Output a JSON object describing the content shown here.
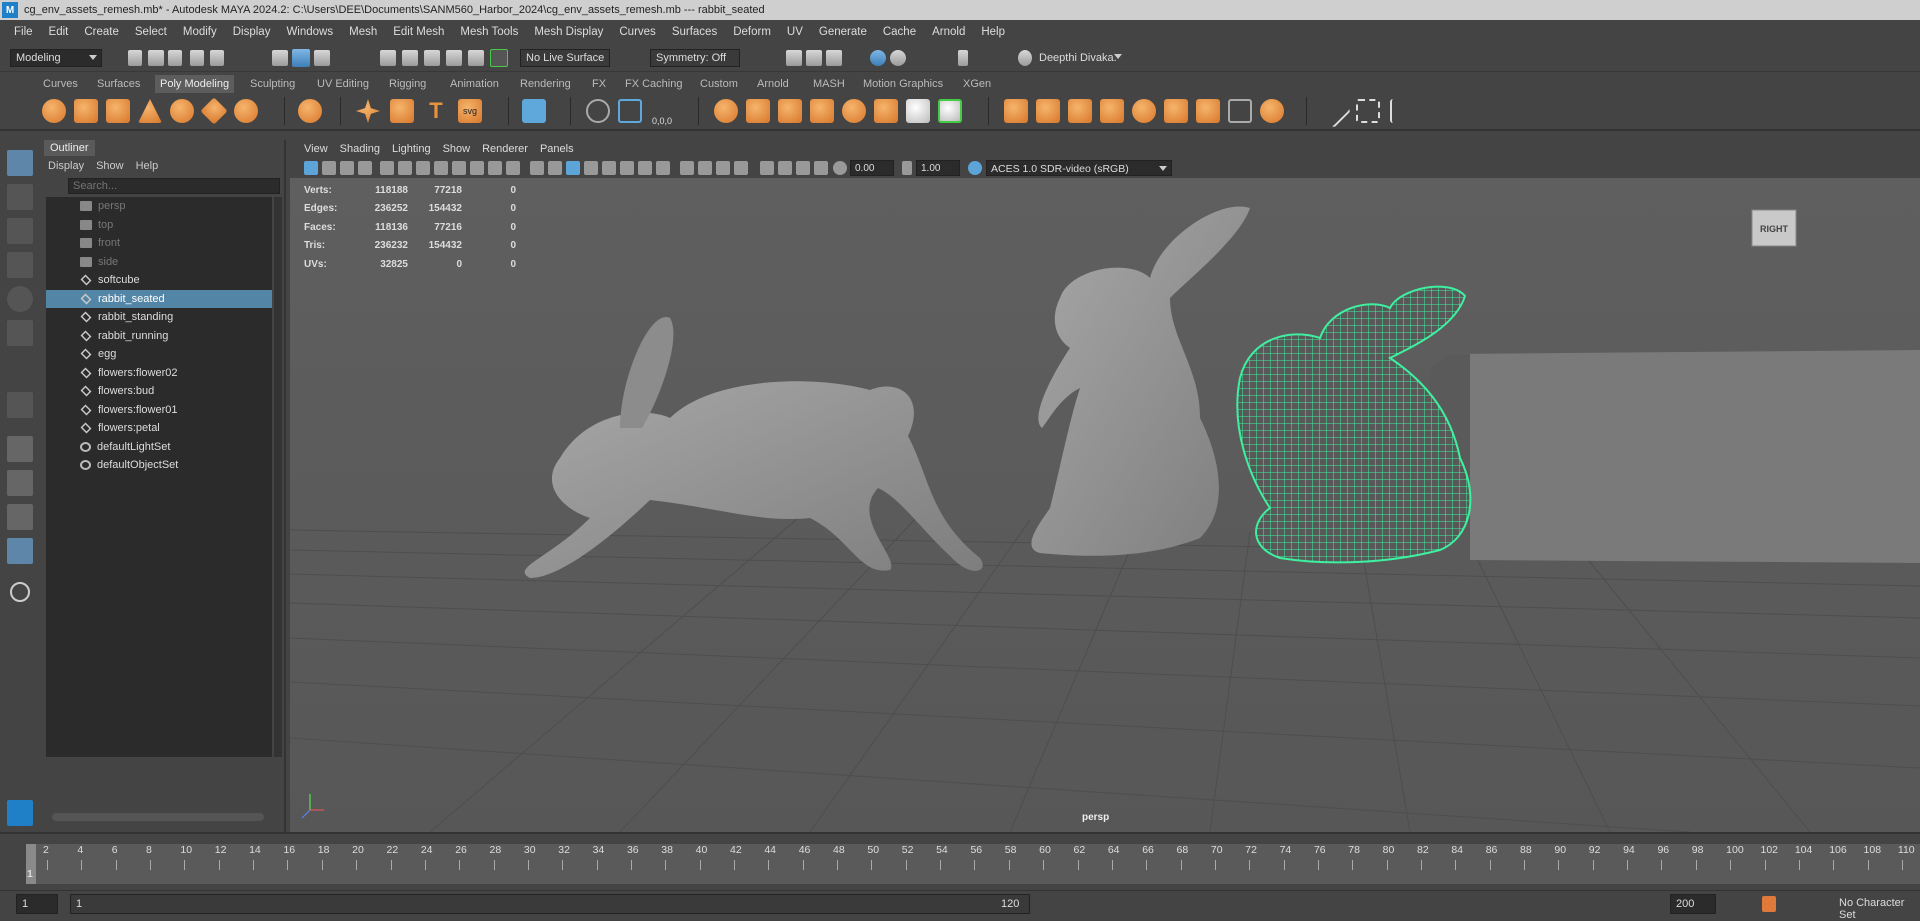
{
  "window": {
    "title": "cg_env_assets_remesh.mb* - Autodesk MAYA 2024.2: C:\\Users\\DEE\\Documents\\SANM560_Harbor_2024\\cg_env_assets_remesh.mb  ---  rabbit_seated",
    "app_badge": "M"
  },
  "menubar": [
    "File",
    "Edit",
    "Create",
    "Select",
    "Modify",
    "Display",
    "Windows",
    "Mesh",
    "Edit Mesh",
    "Mesh Tools",
    "Mesh Display",
    "Curves",
    "Surfaces",
    "Deform",
    "UV",
    "Generate",
    "Cache",
    "Arnold",
    "Help"
  ],
  "statusline": {
    "menuset": "Modeling",
    "live_surface": "No Live Surface",
    "symmetry": "Symmetry: Off",
    "user": "Deepthi Divaka."
  },
  "shelf_tabs": [
    "Curves",
    "Surfaces",
    "Poly Modeling",
    "Sculpting",
    "UV Editing",
    "Rigging",
    "Animation",
    "Rendering",
    "FX",
    "FX Caching",
    "Custom",
    "Arnold",
    "MASH",
    "Motion Graphics",
    "XGen"
  ],
  "shelf_active_tab": "Poly Modeling",
  "shelf_text_icons": {
    "svg": "svg",
    "coord": "0,0,0"
  },
  "outliner": {
    "title": "Outliner",
    "menu": [
      "Display",
      "Show",
      "Help"
    ],
    "search_placeholder": "Search...",
    "items": [
      {
        "label": "persp",
        "type": "camera",
        "dim": true
      },
      {
        "label": "top",
        "type": "camera",
        "dim": true
      },
      {
        "label": "front",
        "type": "camera",
        "dim": true
      },
      {
        "label": "side",
        "type": "camera",
        "dim": true
      },
      {
        "label": "softcube",
        "type": "mesh"
      },
      {
        "label": "rabbit_seated",
        "type": "mesh",
        "selected": true
      },
      {
        "label": "rabbit_standing",
        "type": "mesh"
      },
      {
        "label": "rabbit_running",
        "type": "mesh"
      },
      {
        "label": "egg",
        "type": "mesh"
      },
      {
        "label": "flowers:flower02",
        "type": "mesh"
      },
      {
        "label": "flowers:bud",
        "type": "mesh"
      },
      {
        "label": "flowers:flower01",
        "type": "mesh"
      },
      {
        "label": "flowers:petal",
        "type": "mesh"
      },
      {
        "label": "defaultLightSet",
        "type": "set"
      },
      {
        "label": "defaultObjectSet",
        "type": "set"
      }
    ]
  },
  "viewport": {
    "menu": [
      "View",
      "Shading",
      "Lighting",
      "Show",
      "Renderer",
      "Panels"
    ],
    "exposure": "0.00",
    "gamma": "1.00",
    "color_space": "ACES 1.0 SDR-video (sRGB)",
    "camera_label": "persp",
    "viewcube_label": "RIGHT",
    "hud": [
      {
        "label": "Verts:",
        "a": "118188",
        "b": "77218",
        "c": "0"
      },
      {
        "label": "Edges:",
        "a": "236252",
        "b": "154432",
        "c": "0"
      },
      {
        "label": "Faces:",
        "a": "118136",
        "b": "77216",
        "c": "0"
      },
      {
        "label": "Tris:",
        "a": "236232",
        "b": "154432",
        "c": "0"
      },
      {
        "label": "UVs:",
        "a": "32825",
        "b": "0",
        "c": "0"
      }
    ],
    "wire_color": "#3ef0a0"
  },
  "timeline": {
    "ticks": [
      "2",
      "4",
      "6",
      "8",
      "10",
      "12",
      "14",
      "16",
      "18",
      "20",
      "22",
      "24",
      "26",
      "28",
      "30",
      "32",
      "34",
      "36",
      "38",
      "40",
      "42",
      "44",
      "46",
      "48",
      "50",
      "52",
      "54",
      "56",
      "58",
      "60",
      "62",
      "64",
      "66",
      "68",
      "70",
      "72",
      "74",
      "76",
      "78",
      "80",
      "82",
      "84",
      "86",
      "88",
      "90",
      "92",
      "94",
      "96",
      "98",
      "100",
      "102",
      "104",
      "106",
      "108",
      "110"
    ],
    "current_frame": "1"
  },
  "range": {
    "start": "1",
    "range_start": "1",
    "range_end": "120",
    "end": "200",
    "character_set": "No Character Set"
  }
}
